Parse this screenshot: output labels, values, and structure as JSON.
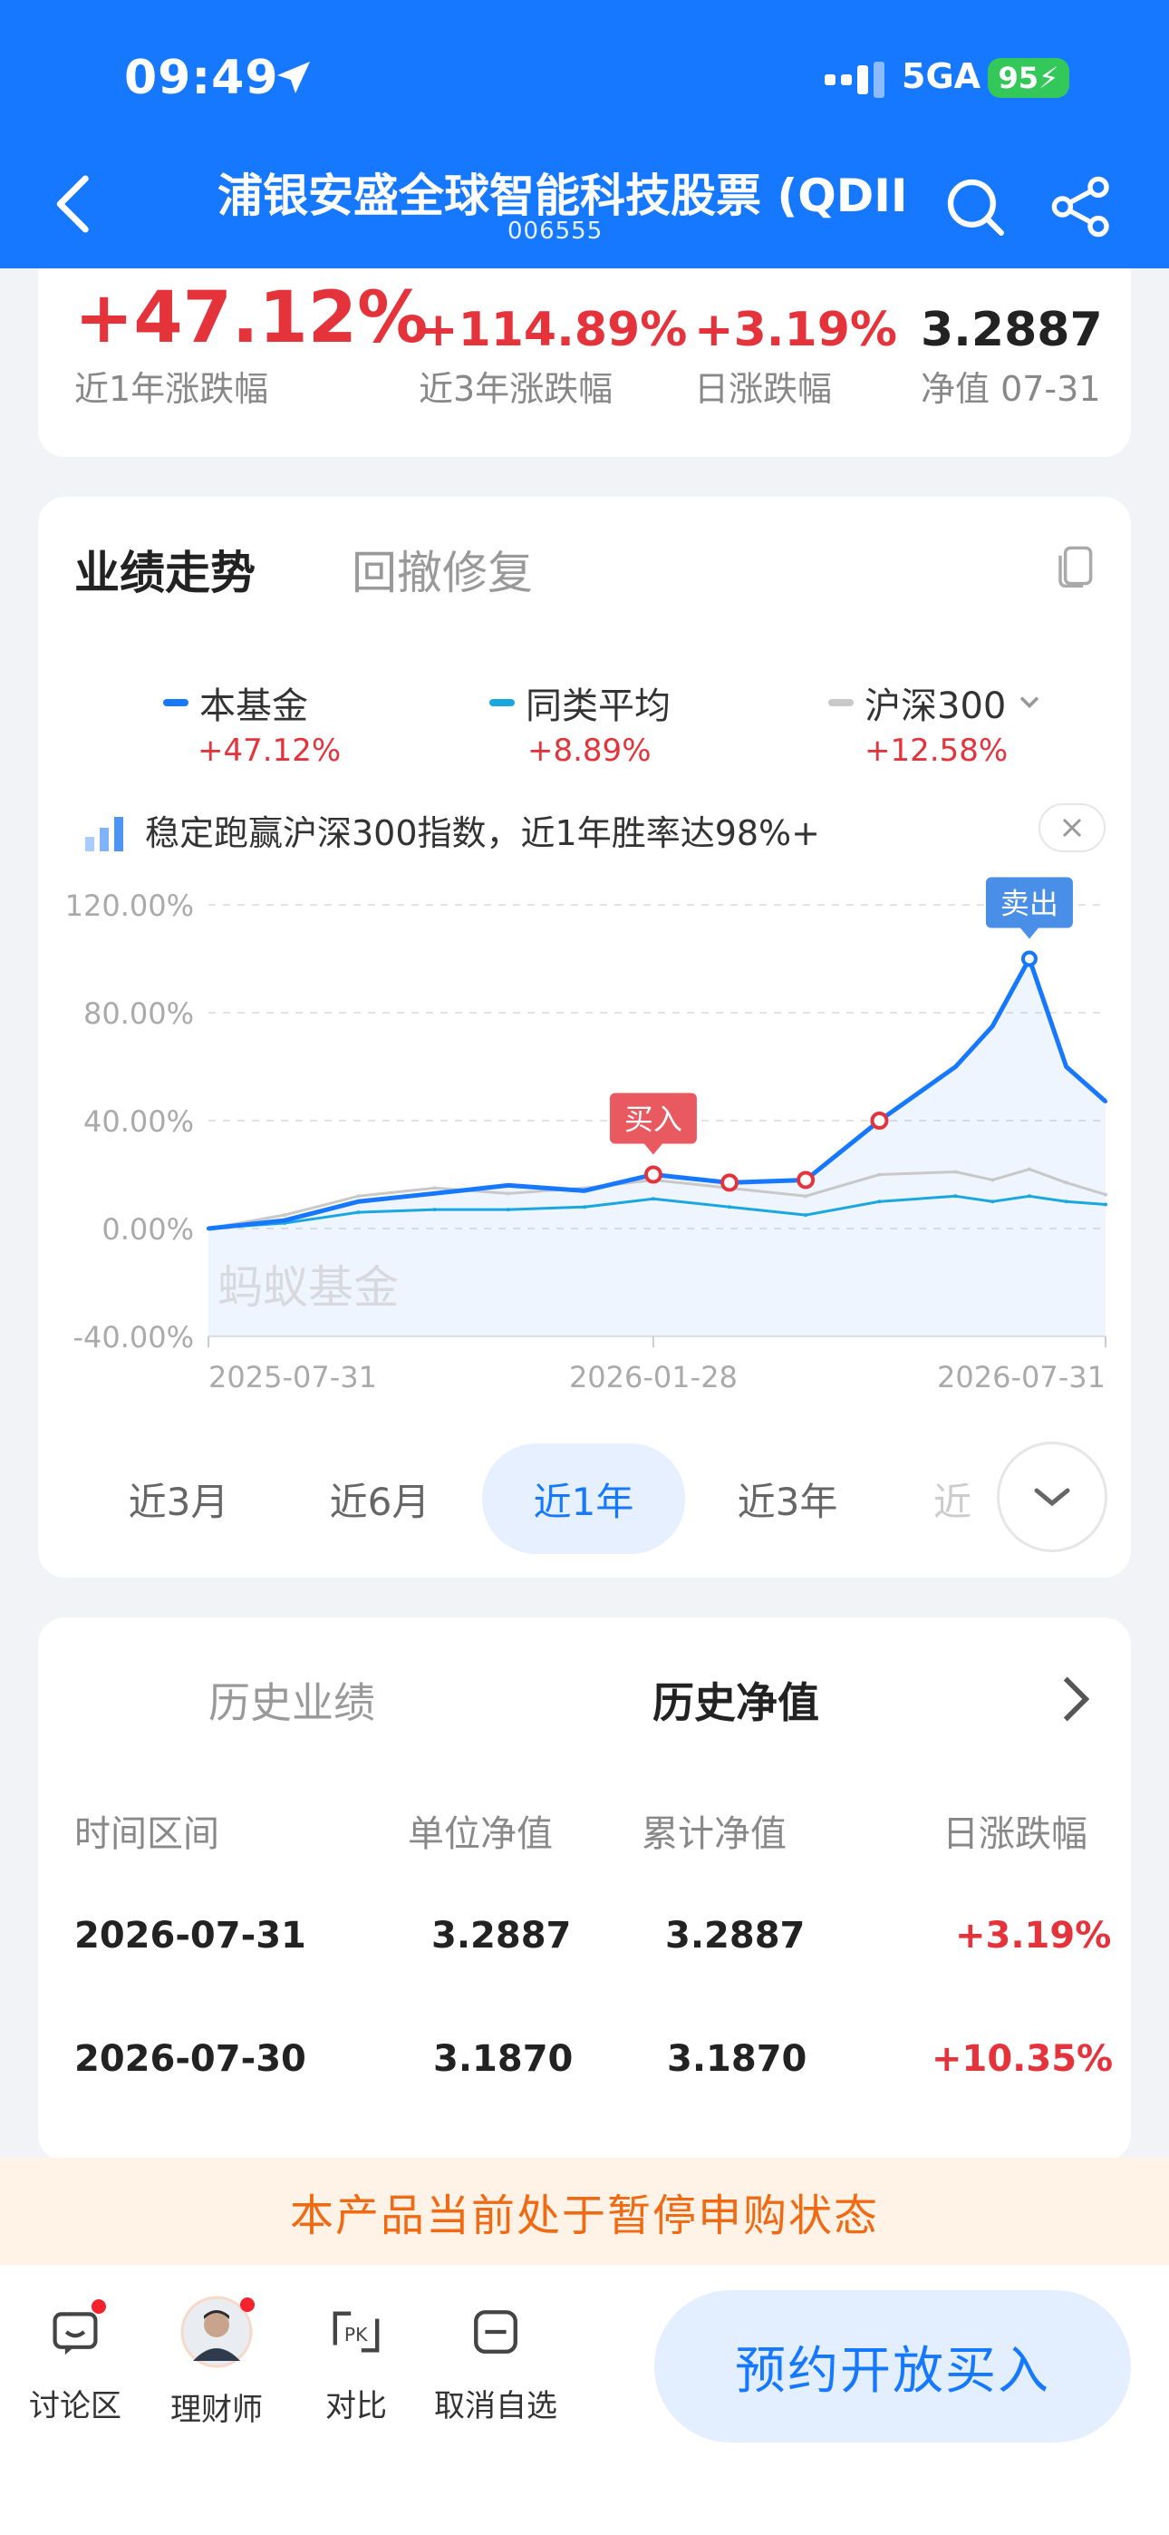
{
  "status_bar": {
    "time": "09:49",
    "network": "5GA",
    "battery": "95"
  },
  "nav": {
    "title": "浦银安盛全球智能科技股票 (QDII",
    "code": "006555"
  },
  "stats": [
    {
      "value": "+47.12%",
      "label": "近1年涨跌幅"
    },
    {
      "value": "+114.89%",
      "label": "近3年涨跌幅"
    },
    {
      "value": "+3.19%",
      "label": "日涨跌幅"
    },
    {
      "value": "3.2887",
      "label": "净值 07-31"
    }
  ],
  "perf": {
    "tabs": [
      "业绩走势",
      "回撤修复"
    ],
    "legend": [
      {
        "name": "本基金",
        "value": "+47.12%",
        "color": "#1677ff"
      },
      {
        "name": "同类平均",
        "value": "+8.89%",
        "color": "#1aa7e0"
      },
      {
        "name": "沪深300",
        "value": "+12.58%",
        "color": "#c8c8c8"
      }
    ],
    "tip": "稳定跑赢沪深300指数，近1年胜率达98%+",
    "watermark": "蚂蚁基金",
    "periods": [
      "近3月",
      "近6月",
      "近1年",
      "近3年",
      "近"
    ],
    "active_period": "近1年"
  },
  "chart_data": {
    "type": "line",
    "ylim": [
      -40,
      120
    ],
    "y_ticks": [
      "120.00%",
      "80.00%",
      "40.00%",
      "0.00%",
      "-40.00%"
    ],
    "x_ticks": [
      "2025-07-31",
      "2026-01-28",
      "2026-07-31"
    ],
    "x": [
      "2025-07-31",
      "2025-08-31",
      "2025-09-30",
      "2025-10-31",
      "2025-11-30",
      "2025-12-31",
      "2026-01-28",
      "2026-02-28",
      "2026-03-31",
      "2026-04-30",
      "2026-05-31",
      "2026-06-15",
      "2026-06-30",
      "2026-07-15",
      "2026-07-31"
    ],
    "series": [
      {
        "name": "本基金",
        "values": [
          0,
          3,
          10,
          13,
          16,
          14,
          20,
          17,
          18,
          40,
          60,
          75,
          100,
          60,
          47.12
        ]
      },
      {
        "name": "同类平均",
        "values": [
          0,
          2,
          6,
          7,
          7,
          8,
          11,
          8,
          5,
          10,
          12,
          10,
          12,
          10,
          8.89
        ]
      },
      {
        "name": "沪深300",
        "values": [
          0,
          5,
          12,
          15,
          13,
          15,
          18,
          15,
          12,
          20,
          21,
          18,
          22,
          17,
          12.58
        ]
      }
    ],
    "annotations": [
      {
        "label": "买入",
        "x": "2026-01-28",
        "y": 20
      },
      {
        "label": "卖出",
        "x": "2026-06-30",
        "y": 100
      }
    ],
    "grid": true
  },
  "history": {
    "tabs": [
      "历史业绩",
      "历史净值"
    ],
    "columns": [
      "时间区间",
      "单位净值",
      "累计净值",
      "日涨跌幅"
    ],
    "rows": [
      [
        "2026-07-31",
        "3.2887",
        "3.2887",
        "+3.19%"
      ],
      [
        "2026-07-30",
        "3.1870",
        "3.1870",
        "+10.35%"
      ]
    ]
  },
  "notice": "本产品当前处于暂停申购状态",
  "bottom": {
    "items": [
      "讨论区",
      "理财师",
      "对比",
      "取消自选"
    ],
    "buy": "预约开放买入"
  }
}
